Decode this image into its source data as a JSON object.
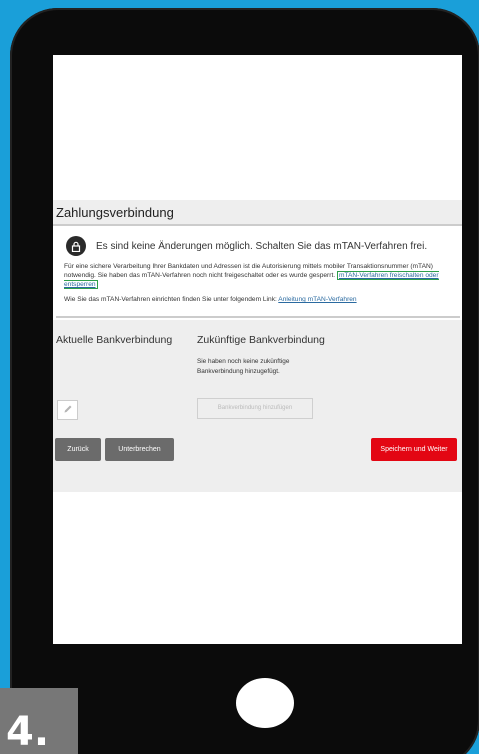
{
  "section": {
    "title": "Zahlungsverbindung"
  },
  "notice": {
    "title": "Es sind keine Änderungen möglich. Schalten Sie das mTAN-Verfahren frei.",
    "body_text": "Für eine sichere Verarbeitung Ihrer Bankdaten und Adressen ist die Autorisierung mittels mobiler Transaktionsnummer (mTAN) notwendig. Sie haben das mTAN-Verfahren noch nicht freigeschaltet oder es wurde gesperrt.",
    "unlock_link": "mTAN-Verfahren freischalten oder entsperren",
    "instructions_text": "Wie Sie das mTAN-Verfahren einrichten finden Sie unter folgendem Link:",
    "instructions_link": "Anleitung mTAN-Verfahren"
  },
  "bank": {
    "current_title": "Aktuelle Bankverbindung",
    "future_title": "Zukünftige Bankverbindung",
    "future_empty_text": "Sie haben noch keine zukünftige Bankverbindung hinzugefügt.",
    "add_button": "Bankverbindung hinzufügen"
  },
  "actions": {
    "back": "Zurück",
    "interrupt": "Unterbrechen",
    "save": "Speichern und Weiter"
  },
  "overlay": {
    "step_label": "4."
  },
  "colors": {
    "background": "#1a9fd9",
    "phone": "#0b0b0b",
    "primary_button": "#e30613",
    "secondary_button": "#6b6b6b"
  }
}
